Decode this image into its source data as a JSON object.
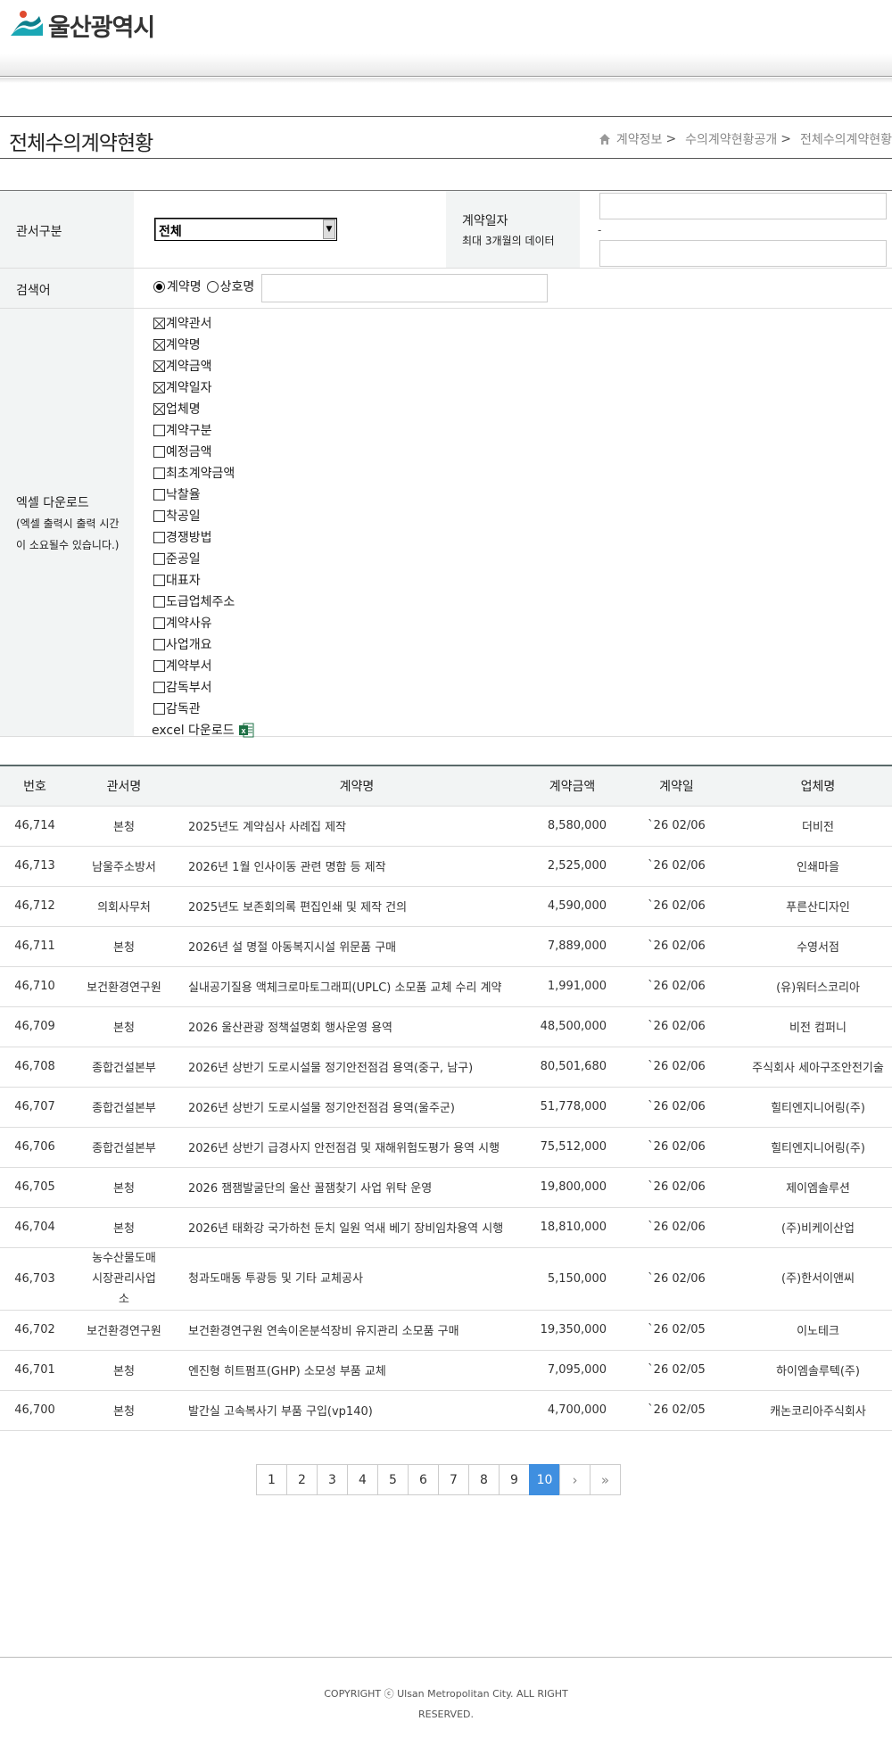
{
  "header": {
    "logo_text": "울산광역시"
  },
  "page": {
    "title": "전체수의계약현황",
    "breadcrumb": [
      "계약정보",
      "수의계약현황공개",
      "전체수의계약현황"
    ]
  },
  "form": {
    "office_label": "관서구분",
    "office_value": "전체",
    "date_label": "계약일자",
    "date_note": "최대 3개월의 데이터",
    "date_dash": "-",
    "keyword_label": "검색어",
    "radio_contract": "계약명",
    "radio_company": "상호명",
    "excel_label_1": "엑셀 다운로드",
    "excel_label_2": "(엑셀 출력시 출력 시간",
    "excel_label_3": "이 소요될수 있습니다.)",
    "checkboxes": [
      {
        "label": "계약관서",
        "checked": true
      },
      {
        "label": "계약명",
        "checked": true
      },
      {
        "label": "계약금액",
        "checked": true
      },
      {
        "label": "계약일자",
        "checked": true
      },
      {
        "label": "업체명",
        "checked": true
      },
      {
        "label": "계약구분",
        "checked": false
      },
      {
        "label": "예정금액",
        "checked": false
      },
      {
        "label": "최초계약금액",
        "checked": false
      },
      {
        "label": "낙찰율",
        "checked": false
      },
      {
        "label": "착공일",
        "checked": false
      },
      {
        "label": "경쟁방법",
        "checked": false
      },
      {
        "label": "준공일",
        "checked": false
      },
      {
        "label": "대표자",
        "checked": false
      },
      {
        "label": "도급업체주소",
        "checked": false
      },
      {
        "label": "계약사유",
        "checked": false
      },
      {
        "label": "사업개요",
        "checked": false
      },
      {
        "label": "계약부서",
        "checked": false
      },
      {
        "label": "감독부서",
        "checked": false
      },
      {
        "label": "감독관",
        "checked": false
      }
    ],
    "excel_download": "excel 다운로드"
  },
  "table": {
    "headers": [
      "번호",
      "관서명",
      "계약명",
      "계약금액",
      "계약일",
      "업체명"
    ],
    "rows": [
      [
        "46,714",
        "본청",
        "2025년도 계약심사 사례집 제작",
        "8,580,000",
        "`26 02/06",
        "더비전"
      ],
      [
        "46,713",
        "남울주소방서",
        "2026년 1월 인사이동 관련 명함 등 제작",
        "2,525,000",
        "`26 02/06",
        "인쇄마을"
      ],
      [
        "46,712",
        "의회사무처",
        "2025년도 보존회의록 편집인쇄 및 제작 건의",
        "4,590,000",
        "`26 02/06",
        "푸른산디자인"
      ],
      [
        "46,711",
        "본청",
        "2026년 설 명절 아동복지시설 위문품 구매",
        "7,889,000",
        "`26 02/06",
        "수영서점"
      ],
      [
        "46,710",
        "보건환경연구원",
        "실내공기질용 액체크로마토그래피(UPLC) 소모품 교체 수리 계약",
        "1,991,000",
        "`26 02/06",
        "(유)워터스코리아"
      ],
      [
        "46,709",
        "본청",
        "2026 울산관광 정책설명회 행사운영 용역",
        "48,500,000",
        "`26 02/06",
        "비전 컴퍼니"
      ],
      [
        "46,708",
        "종합건설본부",
        "2026년 상반기 도로시설물 정기안전점검 용역(중구, 남구)",
        "80,501,680",
        "`26 02/06",
        "주식회사 세아구조안전기술"
      ],
      [
        "46,707",
        "종합건설본부",
        "2026년 상반기 도로시설물 정기안전점검 용역(울주군)",
        "51,778,000",
        "`26 02/06",
        "힐티엔지니어링(주)"
      ],
      [
        "46,706",
        "종합건설본부",
        "2026년 상반기 급경사지 안전점검 및 재해위험도평가 용역 시행",
        "75,512,000",
        "`26 02/06",
        "힐티엔지니어링(주)"
      ],
      [
        "46,705",
        "본청",
        "2026 잼잼발굴단의 울산 꿀잼찾기 사업 위탁 운영",
        "19,800,000",
        "`26 02/06",
        "제이엠솔루션"
      ],
      [
        "46,704",
        "본청",
        "2026년 태화강 국가하천 둔치 일원 억새 베기 장비임차용역 시행",
        "18,810,000",
        "`26 02/06",
        "(주)비케이산업"
      ],
      [
        "46,703",
        "농수산물도매시장관리사업소",
        "청과도매동 투광등 및 기타 교체공사",
        "5,150,000",
        "`26 02/06",
        "(주)한서이앤씨"
      ],
      [
        "46,702",
        "보건환경연구원",
        "보건환경연구원 연속이온분석장비 유지관리 소모품 구매",
        "19,350,000",
        "`26 02/05",
        "이노테크"
      ],
      [
        "46,701",
        "본청",
        "엔진형 히트펌프(GHP) 소모성 부품 교체",
        "7,095,000",
        "`26 02/05",
        "하이엠솔루텍(주)"
      ],
      [
        "46,700",
        "본청",
        "발간실 고속복사기 부품 구입(vp140)",
        "4,700,000",
        "`26 02/05",
        "캐논코리아주식회사"
      ]
    ]
  },
  "pager": {
    "pages": [
      "1",
      "2",
      "3",
      "4",
      "5",
      "6",
      "7",
      "8",
      "9",
      "10"
    ],
    "active": "10",
    "next": "›",
    "last": "»"
  },
  "footer": {
    "copyright": "COPYRIGHT ⓒ Ulsan Metropolitan City. ALL RIGHT RESERVED."
  },
  "colors": {
    "active_page": "#3f8fe0",
    "label_bg": "#f2f4f4",
    "logo_teal": "#1aa7b5"
  }
}
